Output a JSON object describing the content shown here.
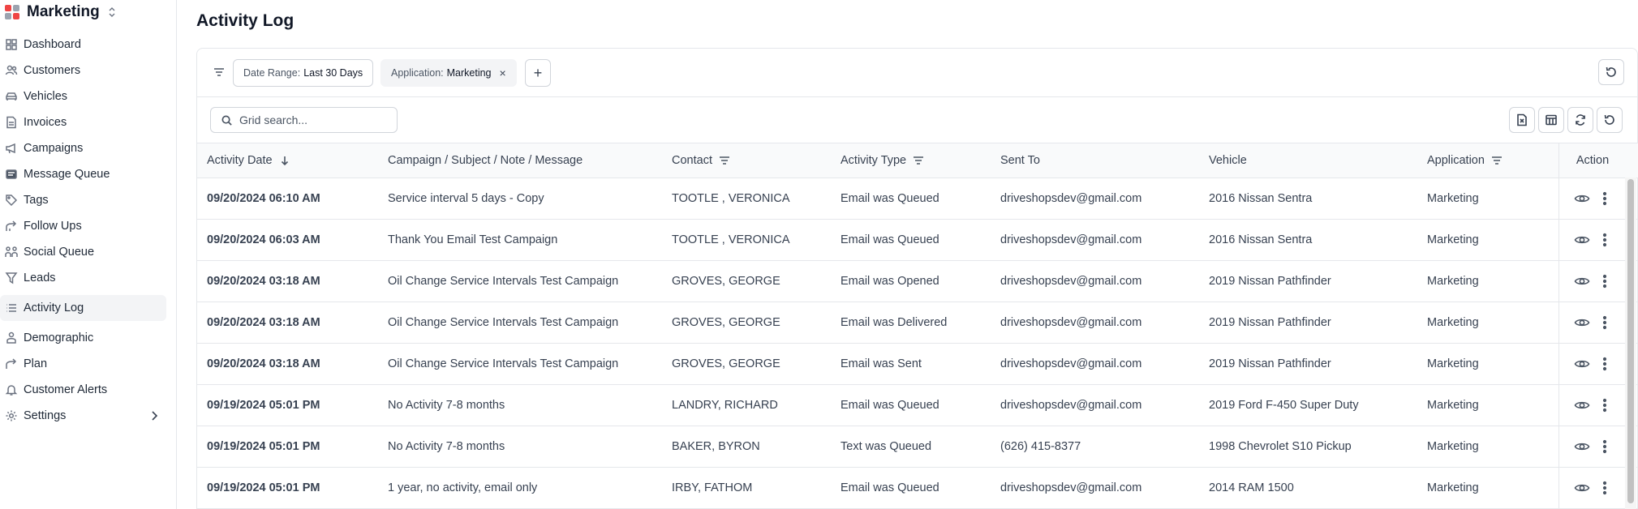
{
  "app": {
    "name": "Marketing",
    "logo_colors": [
      "#ef4444",
      "#9ca3af",
      "#9ca3af",
      "#ef4444"
    ]
  },
  "sidebar": {
    "items": [
      {
        "label": "Dashboard",
        "icon": "dashboard-icon"
      },
      {
        "label": "Customers",
        "icon": "users-icon"
      },
      {
        "label": "Vehicles",
        "icon": "car-icon"
      },
      {
        "label": "Invoices",
        "icon": "invoice-icon"
      },
      {
        "label": "Campaigns",
        "icon": "megaphone-icon"
      },
      {
        "label": "Message Queue",
        "icon": "message-queue-icon"
      },
      {
        "label": "Tags",
        "icon": "tag-icon"
      },
      {
        "label": "Follow Ups",
        "icon": "follow-up-icon"
      },
      {
        "label": "Social Queue",
        "icon": "social-queue-icon"
      },
      {
        "label": "Leads",
        "icon": "funnel-icon"
      },
      {
        "label": "Activity Log",
        "icon": "list-icon",
        "active": true
      },
      {
        "label": "Demographic",
        "icon": "demographic-icon"
      },
      {
        "label": "Plan",
        "icon": "plan-icon"
      },
      {
        "label": "Customer Alerts",
        "icon": "bell-icon"
      },
      {
        "label": "Settings",
        "icon": "gear-icon"
      }
    ]
  },
  "page": {
    "title": "Activity Log"
  },
  "filters": {
    "date_range_key": "Date Range:",
    "date_range_value": "Last 30 Days",
    "application_key": "Application:",
    "application_value": "Marketing",
    "remove_symbol": "×",
    "add_symbol": "+"
  },
  "search": {
    "placeholder": "Grid search..."
  },
  "table": {
    "columns": [
      "Activity Date",
      "Campaign / Subject / Note / Message",
      "Contact",
      "Activity Type",
      "Sent To",
      "Vehicle",
      "Application",
      "Action"
    ],
    "rows": [
      {
        "date": "09/20/2024 06:10 AM",
        "campaign": "Service interval 5 days - Copy",
        "contact": "TOOTLE , VERONICA",
        "type": "Email was Queued",
        "sent_to": "driveshopsdev@gmail.com",
        "vehicle": "2016 Nissan Sentra",
        "application": "Marketing"
      },
      {
        "date": "09/20/2024 06:03 AM",
        "campaign": "Thank You Email Test Campaign",
        "contact": "TOOTLE , VERONICA",
        "type": "Email was Queued",
        "sent_to": "driveshopsdev@gmail.com",
        "vehicle": "2016 Nissan Sentra",
        "application": "Marketing"
      },
      {
        "date": "09/20/2024 03:18 AM",
        "campaign": "Oil Change Service Intervals Test Campaign",
        "contact": "GROVES, GEORGE",
        "type": "Email was Opened",
        "sent_to": "driveshopsdev@gmail.com",
        "vehicle": "2019 Nissan Pathfinder",
        "application": "Marketing"
      },
      {
        "date": "09/20/2024 03:18 AM",
        "campaign": "Oil Change Service Intervals Test Campaign",
        "contact": "GROVES, GEORGE",
        "type": "Email was Delivered",
        "sent_to": "driveshopsdev@gmail.com",
        "vehicle": "2019 Nissan Pathfinder",
        "application": "Marketing"
      },
      {
        "date": "09/20/2024 03:18 AM",
        "campaign": "Oil Change Service Intervals Test Campaign",
        "contact": "GROVES, GEORGE",
        "type": "Email was Sent",
        "sent_to": "driveshopsdev@gmail.com",
        "vehicle": "2019 Nissan Pathfinder",
        "application": "Marketing"
      },
      {
        "date": "09/19/2024 05:01 PM",
        "campaign": "No Activity 7-8 months",
        "contact": "LANDRY, RICHARD",
        "type": "Email was Queued",
        "sent_to": "driveshopsdev@gmail.com",
        "vehicle": "2019 Ford F-450 Super Duty",
        "application": "Marketing"
      },
      {
        "date": "09/19/2024 05:01 PM",
        "campaign": "No Activity 7-8 months",
        "contact": "BAKER, BYRON",
        "type": "Text was Queued",
        "sent_to": "(626) 415-8377",
        "vehicle": "1998 Chevrolet S10 Pickup",
        "application": "Marketing"
      },
      {
        "date": "09/19/2024 05:01 PM",
        "campaign": "1 year, no activity, email only",
        "contact": "IRBY, FATHOM",
        "type": "Email was Queued",
        "sent_to": "driveshopsdev@gmail.com",
        "vehicle": "2014 RAM 1500",
        "application": "Marketing"
      }
    ]
  }
}
